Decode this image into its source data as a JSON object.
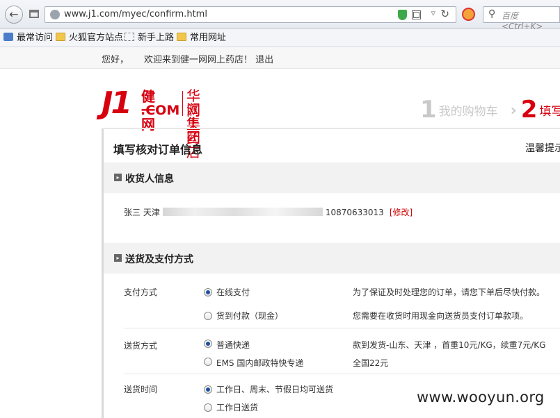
{
  "browser": {
    "url": "www.j1.com/myec/confirm.html",
    "search_placeholder": "百度 <Ctrl+K>"
  },
  "bookmarks": [
    {
      "label": "最常访问"
    },
    {
      "label": "火狐官方站点"
    },
    {
      "label": "新手上路"
    },
    {
      "label": "常用网址"
    }
  ],
  "header": {
    "greeting": "您好，",
    "welcome": "欢迎来到健一网网上药店！",
    "logout": "退出"
  },
  "logo": {
    "j1": "J1",
    "brand_top": "健一网",
    "brand_bottom": ".COM",
    "partner_top": "华润集团",
    "partner_bottom": "网上药店"
  },
  "steps": [
    {
      "num": "1",
      "label": "我的购物车"
    },
    {
      "num": "2",
      "label": "填写"
    }
  ],
  "order": {
    "title": "填写核对订单信息",
    "tip": "温馨提示"
  },
  "receiver_section": {
    "title": "收货人信息",
    "name_prefix": "张三 天津",
    "phone": "10870633013",
    "modify": "[修改]"
  },
  "delivery_section": {
    "title": "送货及支付方式",
    "payment": {
      "label": "支付方式",
      "options": [
        {
          "label": "在线支付",
          "checked": true,
          "note": "为了保证及时处理您的订单，请您下单后尽快付款。"
        },
        {
          "label": "货到付款（现金）",
          "checked": false,
          "note": "您需要在收货时用现金向送货员支付订单款项。"
        }
      ]
    },
    "shipping": {
      "label": "送货方式",
      "options": [
        {
          "label": "普通快递",
          "checked": true,
          "note": "款到发货-山东、天津 ，首重10元/KG，续重7元/KG"
        },
        {
          "label": "EMS 国内邮政特快专递",
          "checked": false,
          "note": "全国22元"
        }
      ]
    },
    "time": {
      "label": "送货时间",
      "options": [
        {
          "label": "工作日、周末、节假日均可送货",
          "checked": true
        },
        {
          "label": "工作日送货",
          "checked": false
        }
      ]
    }
  },
  "watermark": "www.wooyun.org"
}
